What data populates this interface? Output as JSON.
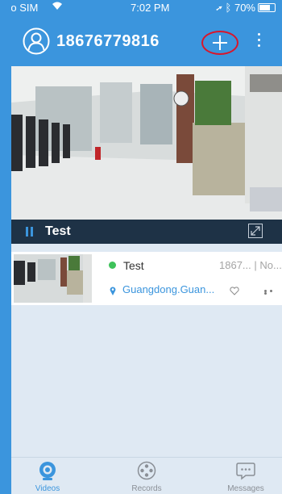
{
  "status_bar": {
    "carrier": "No SIM",
    "time": "7:02 PM",
    "battery": "70%"
  },
  "header": {
    "phone_number": "18676779816"
  },
  "video_bar": {
    "camera_name": "Test"
  },
  "devices": [
    {
      "name": "Test",
      "id": "1867... | No...",
      "location": "Guangdong.Guan...",
      "status_color": "#3ec25a"
    }
  ],
  "tabs": [
    {
      "label": "Videos",
      "icon": "camera-icon",
      "active": true
    },
    {
      "label": "Records",
      "icon": "film-reel-icon",
      "active": false
    },
    {
      "label": "Messages",
      "icon": "chat-bubble-icon",
      "active": false
    }
  ],
  "colors": {
    "brand_blue": "#3b95dd",
    "highlight_circle": "#d8162b",
    "video_bar": "#1e3246"
  }
}
